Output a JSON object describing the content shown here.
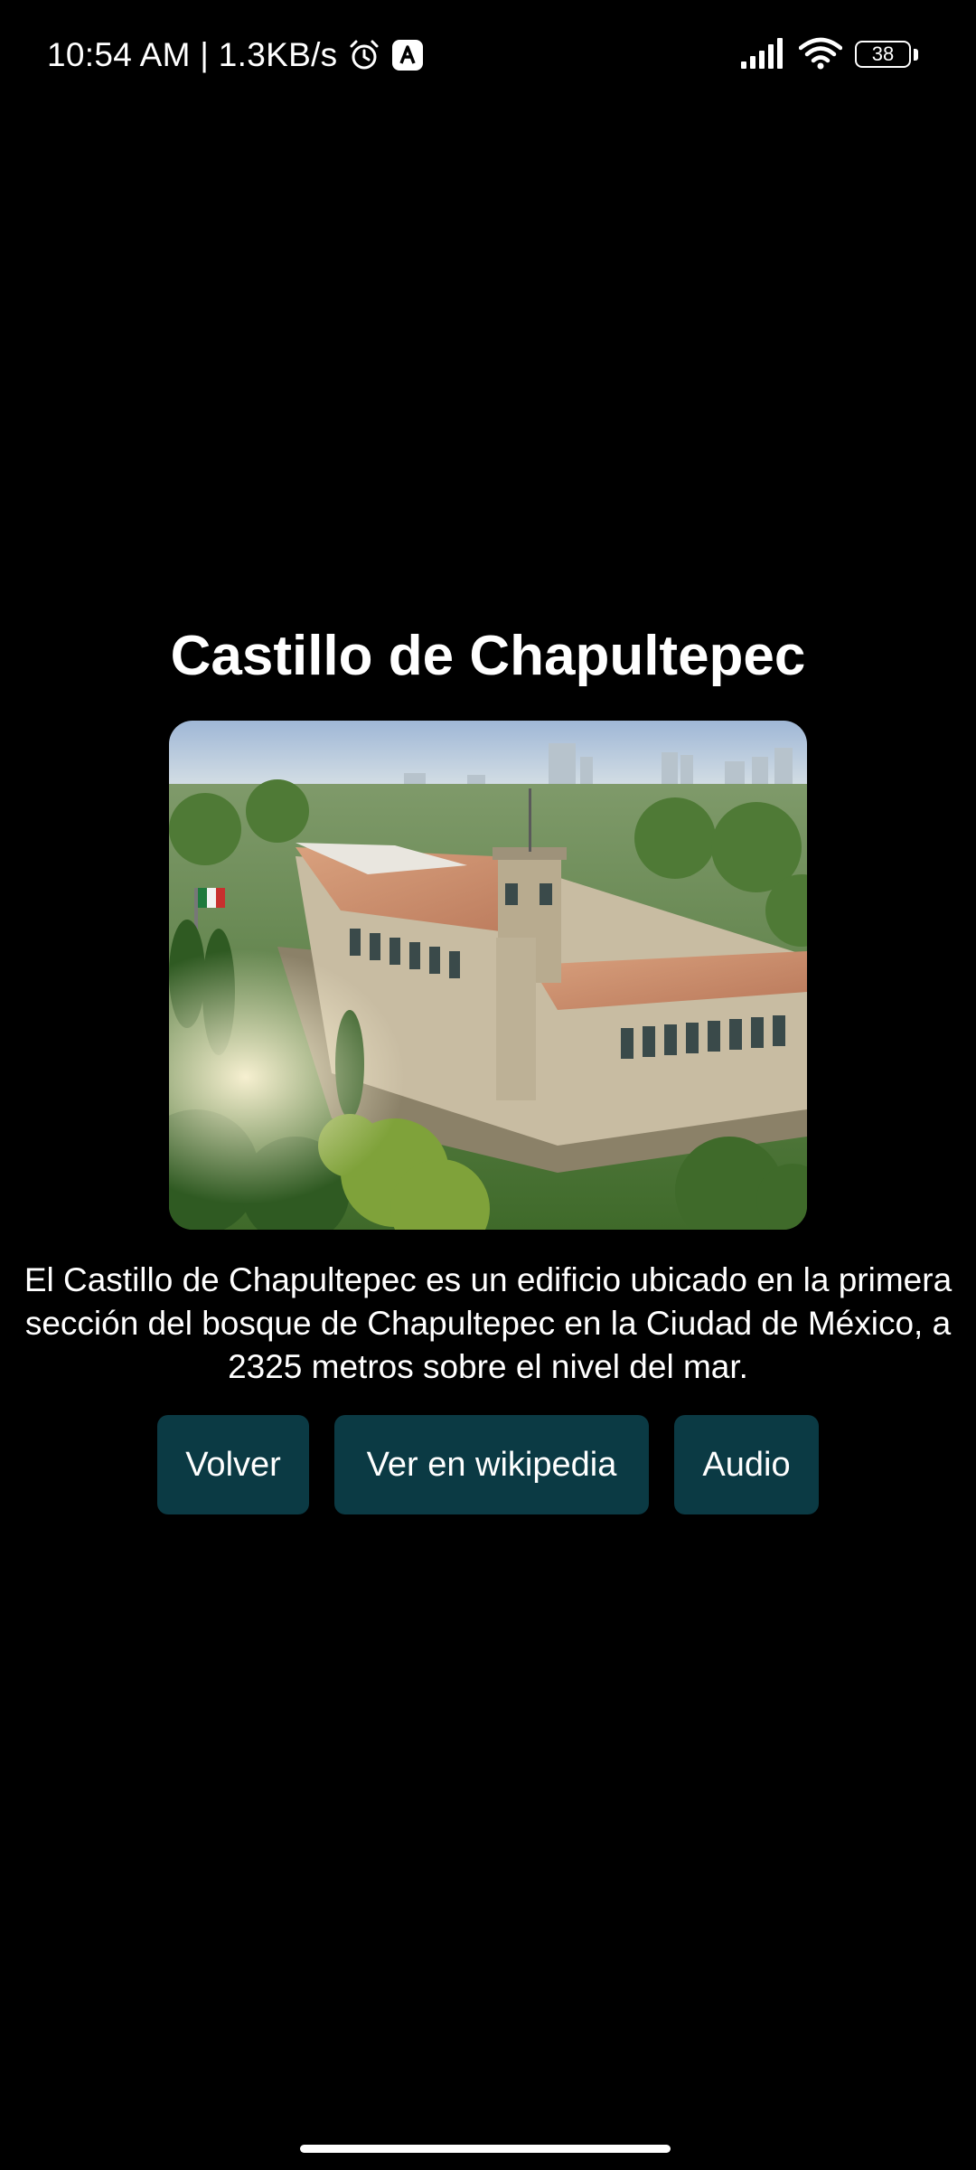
{
  "status_bar": {
    "time_text": "10:54 AM | 1.3KB/s",
    "battery_level": "38",
    "alarm_icon": "alarm-clock-icon",
    "app_icon": "app-notification-icon",
    "signal_icon": "cellular-signal-icon",
    "wifi_icon": "wifi-icon"
  },
  "place": {
    "title": "Castillo de Chapultepec",
    "description": "El Castillo de Chapultepec es un edificio ubicado en la primera sección del bosque de Chapultepec en la Ciudad de México, a 2325 metros sobre el nivel del mar."
  },
  "actions": {
    "back_label": "Volver",
    "wiki_label": "Ver en wikipedia",
    "audio_label": "Audio"
  },
  "colors": {
    "background": "#000000",
    "button_bg": "#0b3a44",
    "text": "#ffffff"
  }
}
